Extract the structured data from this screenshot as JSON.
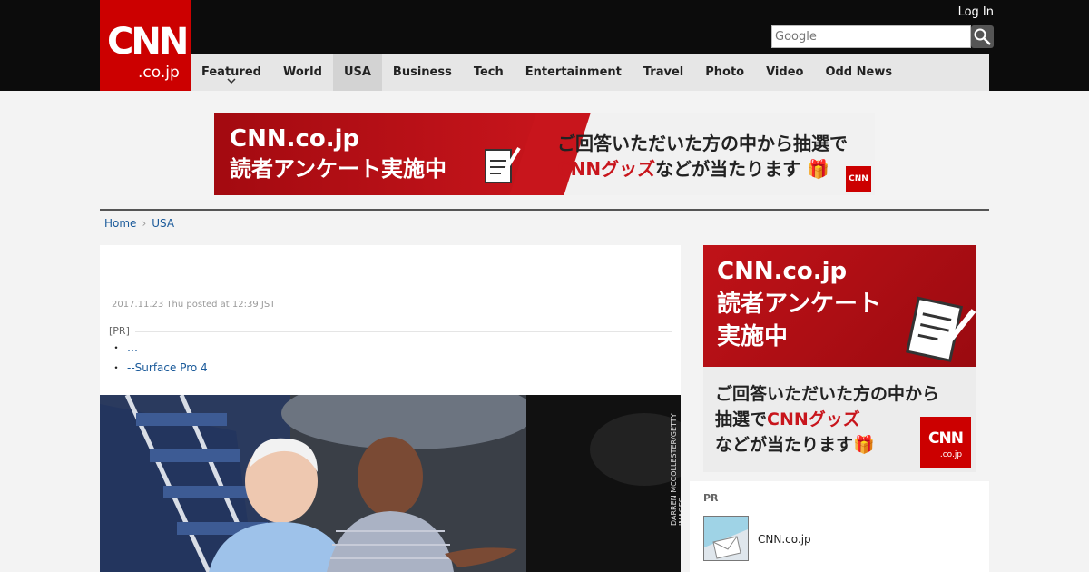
{
  "header": {
    "logo_main": "CNN",
    "logo_sub": ".co.jp",
    "login": "Log In",
    "search": {
      "placeholder": "Google"
    }
  },
  "nav": {
    "items": [
      {
        "label": "Featured"
      },
      {
        "label": "World"
      },
      {
        "label": "USA"
      },
      {
        "label": "Business"
      },
      {
        "label": "Tech"
      },
      {
        "label": "Entertainment"
      },
      {
        "label": "Travel"
      },
      {
        "label": "Photo"
      },
      {
        "label": "Video"
      },
      {
        "label": "Odd News"
      }
    ],
    "active": "USA"
  },
  "banner": {
    "line1": "CNN.co.jp",
    "line2": "読者アンケート実施中",
    "line3": "ご回答いただいた方の中から抽選で",
    "line4_red": "CNNグッズ",
    "line4_rest": "などが当たります",
    "badge": "CNN"
  },
  "breadcrumb": {
    "home": "Home",
    "separator": "›",
    "current": "USA"
  },
  "article": {
    "date": "2017.11.23 Thu posted at 12:39 JST",
    "pr_label": "[PR]",
    "pr_links": [
      "…",
      "--Surface Pro 4"
    ],
    "photo_credit": "DARREN MCCOLLESTER/GETTY IMAGES"
  },
  "side_ad": {
    "line1": "CNN.co.jp",
    "line2": "読者アンケート",
    "line3": "実施中",
    "line4": "ご回答いただいた方の中から",
    "line5_prefix": "抽選で",
    "line5_red": "CNNグッズ",
    "line6": "などが当たります",
    "badge_main": "CNN",
    "badge_sub": ".co.jp"
  },
  "pr_box": {
    "label": "PR",
    "item_name": "CNN.co.jp"
  },
  "colors": {
    "brand_red": "#cc0000",
    "header_bg": "#0c0c0c",
    "nav_bg": "#e6e6e6",
    "link": "#1a5a9a"
  }
}
